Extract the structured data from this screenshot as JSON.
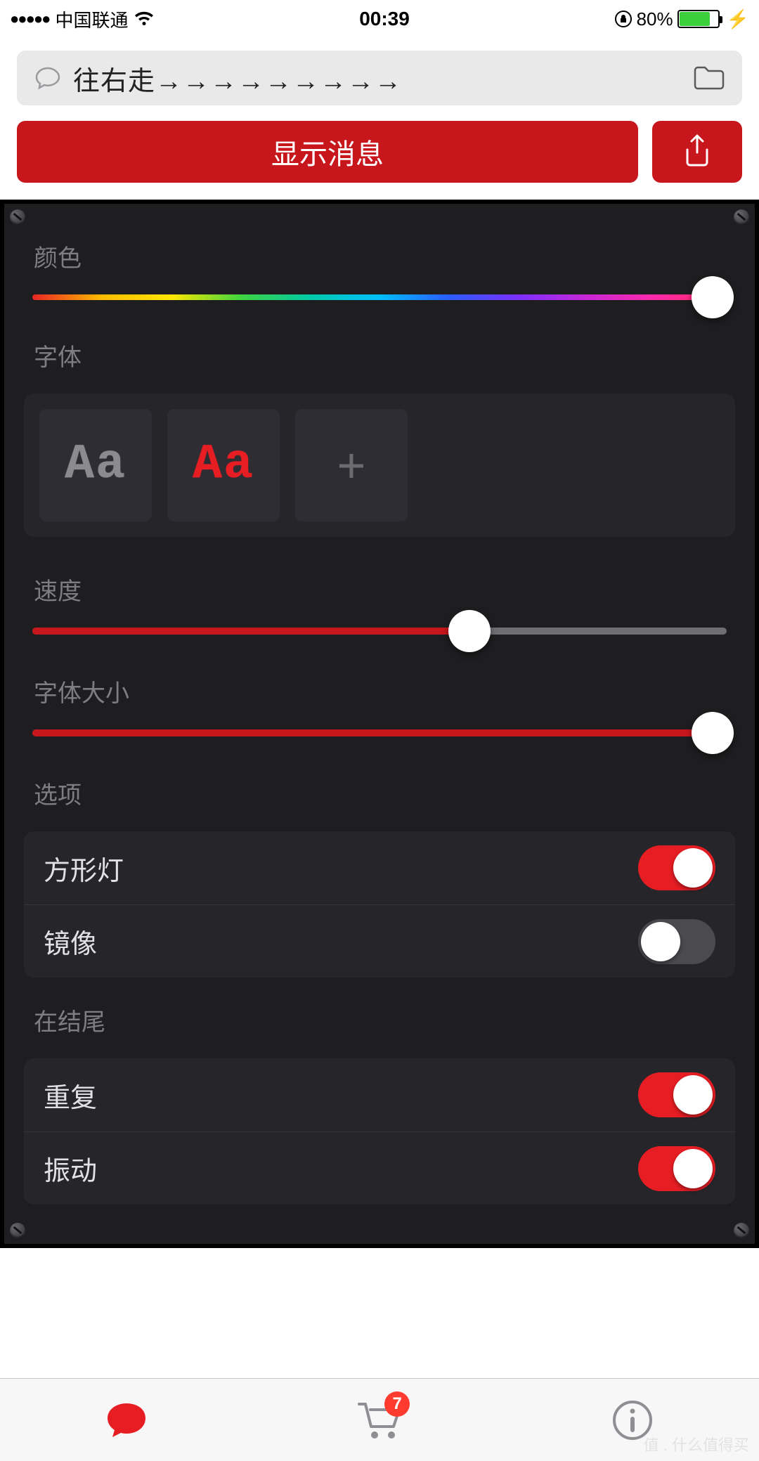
{
  "statusbar": {
    "carrier": "中国联通",
    "signal_dots": "●●●●●",
    "time": "00:39",
    "battery_percent": "80%",
    "battery_fill_pct": 78
  },
  "input": {
    "text": "往右走→→→→→→→→→"
  },
  "buttons": {
    "show_message": "显示消息"
  },
  "sections": {
    "color": "颜色",
    "font": "字体",
    "speed": "速度",
    "font_size": "字体大小",
    "options": "选项",
    "at_end": "在结尾"
  },
  "sliders": {
    "color_pct": 98,
    "speed_pct": 63,
    "font_size_pct": 98
  },
  "fonts": {
    "sample1": "Aa",
    "sample2": "Aa",
    "add": "+",
    "color1": "#8a8a8f",
    "color2": "#e71d24",
    "color3": "#6b6b70"
  },
  "options_group": [
    {
      "label": "方形灯",
      "on": true
    },
    {
      "label": "镜像",
      "on": false
    }
  ],
  "end_group": [
    {
      "label": "重复",
      "on": true
    },
    {
      "label": "振动",
      "on": true
    }
  ],
  "tabbar": {
    "cart_badge": "7"
  },
  "watermark": "值 . 什么值得买"
}
